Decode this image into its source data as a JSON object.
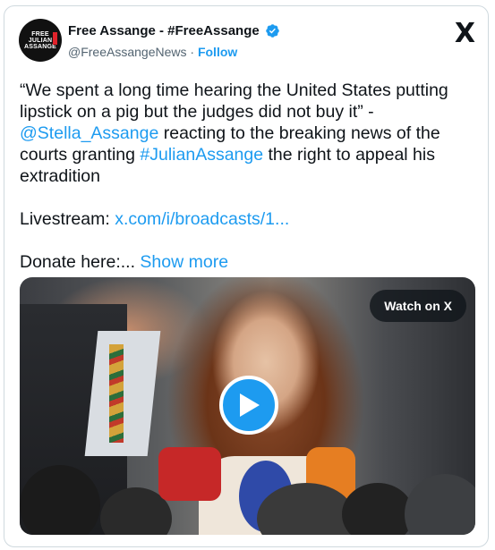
{
  "author": {
    "display_name": "Free Assange - #FreeAssange",
    "handle": "@FreeAssangeNews",
    "separator": "·",
    "follow_label": "Follow",
    "avatar_lines": [
      "FREE",
      "JULIAN",
      "ASSANGE"
    ],
    "verified": true,
    "verified_color": "#1d9bf0"
  },
  "platform_logo": "X",
  "tweet": {
    "line1": "“We spent a long time hearing the United States putting lipstick on a pig but the judges did not buy it” -",
    "mention": "@Stella_Assange",
    "line2": " reacting to the breaking news of the courts granting ",
    "hashtag": "#JulianAssange",
    "line3": " the right to appeal his extradition",
    "livestream_label": "Livestream: ",
    "livestream_link": "x.com/i/broadcasts/1...",
    "donate_label": "Donate here:... ",
    "show_more": "Show more"
  },
  "media": {
    "watch_label": "Watch on X",
    "play_icon": "play-icon",
    "accent": "#1d9bf0"
  }
}
